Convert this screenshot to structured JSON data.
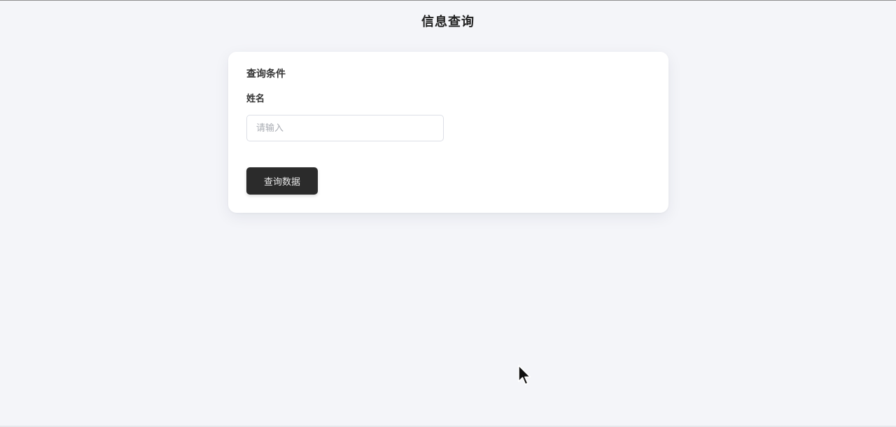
{
  "header": {
    "title": "信息查询"
  },
  "query_card": {
    "section_title": "查询条件",
    "name_field": {
      "label": "姓名",
      "value": "",
      "placeholder": "请输入"
    },
    "submit_label": "查询数据"
  },
  "icons": {
    "cursor": "mouse-pointer-icon"
  },
  "colors": {
    "background": "#f4f5f9",
    "card": "#ffffff",
    "button": "#2b2b2b",
    "button_text": "#e9e9e9",
    "input_border": "#dcdfe6"
  }
}
